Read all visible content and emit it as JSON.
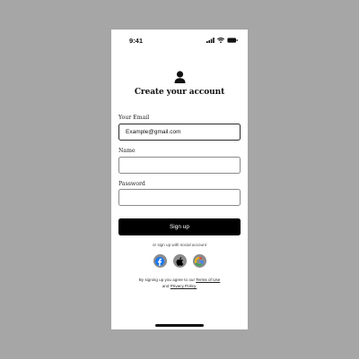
{
  "status_bar": {
    "time": "9:41",
    "icons": [
      "cellular-signal-icon",
      "wifi-icon",
      "battery-icon"
    ]
  },
  "header": {
    "icon": "user-icon",
    "title": "Create your account"
  },
  "form": {
    "email": {
      "label": "Your Email",
      "value": "Example@gmail.com",
      "placeholder": ""
    },
    "name": {
      "label": "Name",
      "value": "",
      "placeholder": ""
    },
    "password": {
      "label": "Password",
      "value": "",
      "placeholder": ""
    },
    "submit_label": "Sign up"
  },
  "social": {
    "caption": "or sign up with social account",
    "providers": [
      {
        "name": "facebook-icon",
        "color": "#1877F2"
      },
      {
        "name": "apple-icon",
        "color": "#000000"
      },
      {
        "name": "google-icon",
        "color": "#EA4335"
      }
    ]
  },
  "terms": {
    "prefix": "By signing up you agree to our",
    "terms_link": "Terms of Use",
    "conjunction": "and",
    "privacy_link": "Privacy Policy."
  },
  "colors": {
    "background": "#A6A6A6",
    "screen": "#FFFFFF",
    "button": "#000000",
    "social_circle": "#8C8C8C"
  }
}
